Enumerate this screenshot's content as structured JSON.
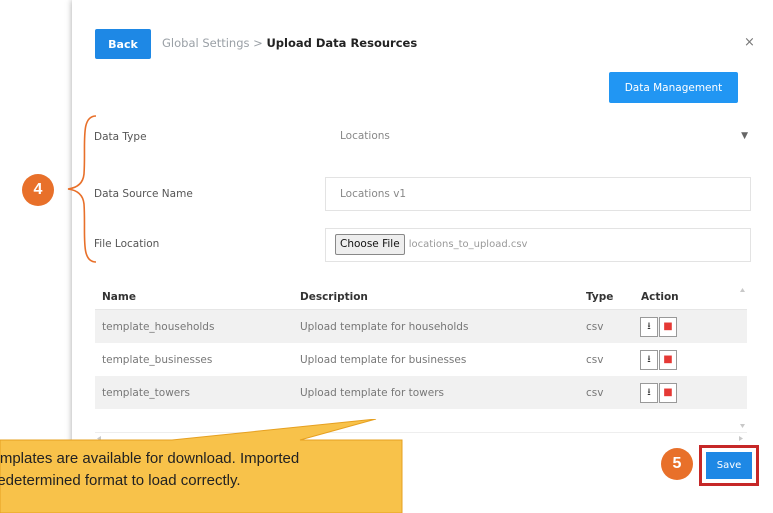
{
  "header": {
    "back_label": "Back",
    "crumb_parent": "Global Settings",
    "crumb_sep": " > ",
    "crumb_current": "Upload Data Resources",
    "close_glyph": "×"
  },
  "toolbar": {
    "data_management_label": "Data Management"
  },
  "form": {
    "data_type_label": "Data Type",
    "data_type_value": "Locations",
    "data_source_label": "Data Source Name",
    "data_source_value": "Locations v1",
    "file_location_label": "File Location",
    "choose_file_label": "Choose File",
    "file_name": "locations_to_upload.csv"
  },
  "table": {
    "headers": {
      "name": "Name",
      "description": "Description",
      "type": "Type",
      "action": "Action"
    },
    "rows": [
      {
        "name": "template_households",
        "description": "Upload template for households",
        "type": "csv"
      },
      {
        "name": "template_businesses",
        "description": "Upload template for businesses",
        "type": "csv"
      },
      {
        "name": "template_towers",
        "description": "Upload template for towers",
        "type": "csv"
      }
    ]
  },
  "footer": {
    "save_label": "Save"
  },
  "annotations": {
    "badge_4": "4",
    "badge_5": "5",
    "callout_line1": "Templates are available for download. Imported",
    "callout_line2": "predetermined format to load correctly."
  },
  "colors": {
    "primary": "#1e88e5",
    "annotation_orange": "#e8702a",
    "callout_fill": "#f8c24a",
    "highlight_red": "#c62828"
  }
}
